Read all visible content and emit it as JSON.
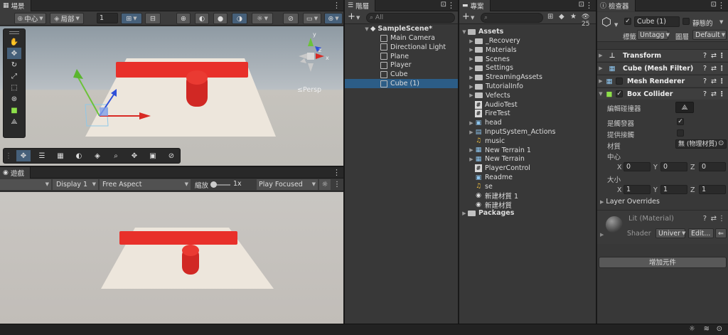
{
  "scene": {
    "tab": "場景",
    "pivot": "中心",
    "space": "局部",
    "grid_snap": "1",
    "persp_label": "≤Persp"
  },
  "game": {
    "tab": "遊戲",
    "display": "Display 1",
    "aspect": "Free Aspect",
    "zoom_label": "縮放",
    "zoom_value": "1x",
    "play_mode": "Play Focused"
  },
  "hierarchy": {
    "tab": "階層",
    "search_placeholder": "All",
    "scene_name": "SampleScene*",
    "items": [
      "Main Camera",
      "Directional Light",
      "Plane",
      "Player",
      "Cube",
      "Cube (1)"
    ]
  },
  "project": {
    "tab": "專案",
    "badge": "25",
    "root": "Assets",
    "items": [
      {
        "label": "_Recovery",
        "kind": "folder"
      },
      {
        "label": "Materials",
        "kind": "folder"
      },
      {
        "label": "Scenes",
        "kind": "folder"
      },
      {
        "label": "Settings",
        "kind": "folder"
      },
      {
        "label": "StreamingAssets",
        "kind": "folder"
      },
      {
        "label": "TutorialInfo",
        "kind": "folder"
      },
      {
        "label": "Vefects",
        "kind": "folder"
      },
      {
        "label": "AudioTest",
        "kind": "script"
      },
      {
        "label": "FireTest",
        "kind": "script"
      },
      {
        "label": "head",
        "kind": "model"
      },
      {
        "label": "InputSystem_Actions",
        "kind": "asset"
      },
      {
        "label": "music",
        "kind": "audio"
      },
      {
        "label": "New Terrain 1",
        "kind": "terrain"
      },
      {
        "label": "New Terrain",
        "kind": "terrain"
      },
      {
        "label": "PlayerControl",
        "kind": "script"
      },
      {
        "label": "Readme",
        "kind": "readme"
      },
      {
        "label": "se",
        "kind": "audio"
      },
      {
        "label": "新建材質 1",
        "kind": "material"
      },
      {
        "label": "新建材質",
        "kind": "material"
      }
    ],
    "packages": "Packages"
  },
  "inspector": {
    "tab": "檢查器",
    "object_name": "Cube (1)",
    "static_label": "靜態的",
    "tag_label": "標籤",
    "tag_value": "Untagg",
    "layer_label": "圖層",
    "layer_value": "Default",
    "components": [
      "Transform",
      "Cube (Mesh Filter)",
      "Mesh Renderer",
      "Box Collider"
    ],
    "box_collider": {
      "edit_label": "編輯碰撞器",
      "trigger_label": "是觸發器",
      "provides_label": "提供接觸",
      "material_label": "材質",
      "material_value": "無 (物理材質)",
      "center_label": "中心",
      "center": {
        "x": "0",
        "y": "0",
        "z": "0"
      },
      "size_label": "大小",
      "size": {
        "x": "1",
        "y": "1",
        "z": "1"
      },
      "layer_overrides": "Layer Overrides"
    },
    "material": {
      "name": "Lit (Material)",
      "shader_label": "Shader",
      "shader_value": "Univer",
      "edit_label": "Edit..."
    },
    "add_component": "增加元件"
  },
  "colors": {
    "selection": "#2c5d87",
    "red": "#e8302a",
    "panel": "#383838",
    "dark": "#282828"
  }
}
